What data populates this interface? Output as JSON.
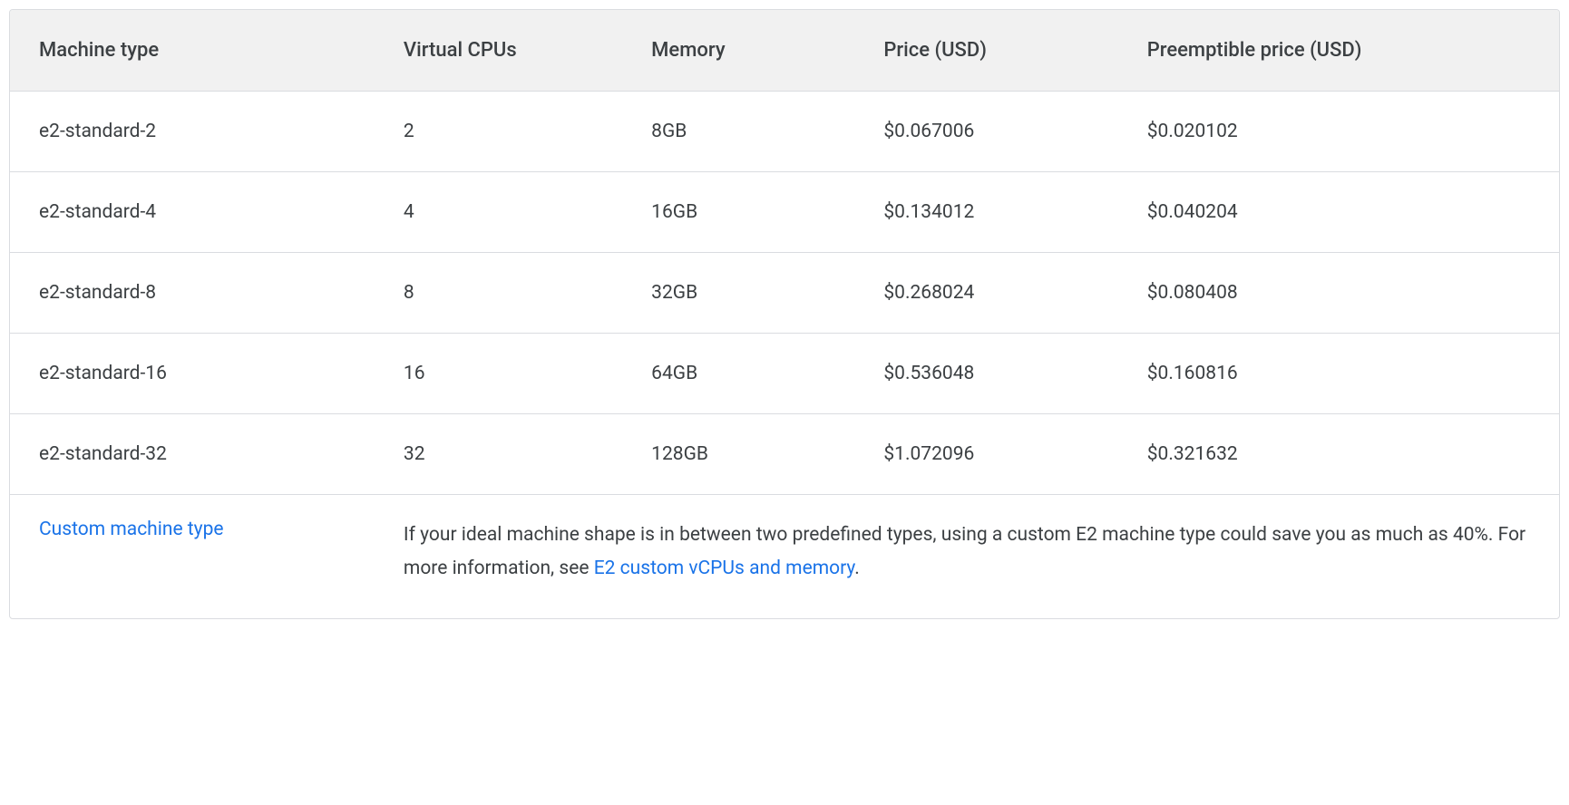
{
  "table": {
    "headers": {
      "machine_type": "Machine type",
      "virtual_cpus": "Virtual CPUs",
      "memory": "Memory",
      "price": "Price (USD)",
      "preemptible_price": "Preemptible price (USD)"
    },
    "rows": [
      {
        "machine_type": "e2-standard-2",
        "virtual_cpus": "2",
        "memory": "8GB",
        "price": "$0.067006",
        "preemptible_price": "$0.020102"
      },
      {
        "machine_type": "e2-standard-4",
        "virtual_cpus": "4",
        "memory": "16GB",
        "price": "$0.134012",
        "preemptible_price": "$0.040204"
      },
      {
        "machine_type": "e2-standard-8",
        "virtual_cpus": "8",
        "memory": "32GB",
        "price": "$0.268024",
        "preemptible_price": "$0.080408"
      },
      {
        "machine_type": "e2-standard-16",
        "virtual_cpus": "16",
        "memory": "64GB",
        "price": "$0.536048",
        "preemptible_price": "$0.160816"
      },
      {
        "machine_type": "e2-standard-32",
        "virtual_cpus": "32",
        "memory": "128GB",
        "price": "$1.072096",
        "preemptible_price": "$0.321632"
      }
    ],
    "footer": {
      "link_label": "Custom machine type",
      "text_before": "If your ideal machine shape is in between two predefined types, using a custom E2 machine type could save you as much as 40%. For more information, see ",
      "inline_link": "E2 custom vCPUs and memory",
      "text_after": "."
    }
  }
}
